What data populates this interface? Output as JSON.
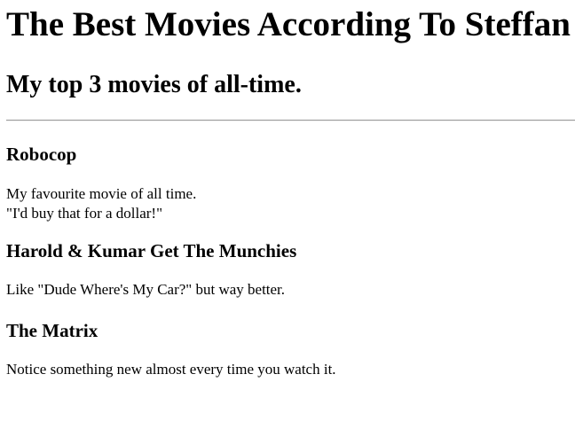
{
  "header": {
    "title": "The Best Movies According To Steffan",
    "subtitle": "My top 3 movies of all-time."
  },
  "movies": [
    {
      "title": "Robocop",
      "description_lines": [
        "My favourite movie of all time.",
        "\"I'd buy that for a dollar!\""
      ]
    },
    {
      "title": "Harold & Kumar Get The Munchies",
      "description_lines": [
        "Like \"Dude Where's My Car?\" but way better."
      ]
    },
    {
      "title": "The Matrix",
      "description_lines": [
        "Notice something new almost every time you watch it."
      ]
    }
  ]
}
